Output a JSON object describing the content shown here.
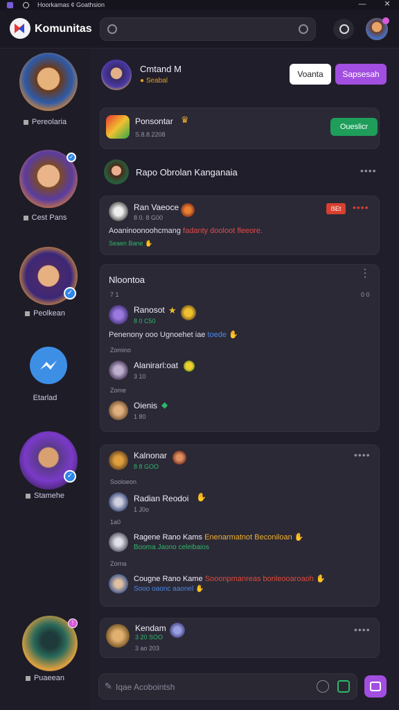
{
  "titlebar": {
    "text": "Hoorkamas ¢ Goathsion"
  },
  "header": {
    "app_name": "Komunitas"
  },
  "sidebar": {
    "items": [
      {
        "label": "Pereolaria"
      },
      {
        "label": "Cest Pans"
      },
      {
        "label": "Peolkean"
      },
      {
        "label": "Etarlad"
      },
      {
        "label": "Stamehe"
      },
      {
        "label": "Puaeean"
      }
    ]
  },
  "profile": {
    "name": "Cmtand M",
    "sub": "Seabal",
    "btn_view": "Voanta",
    "btn_search": "Sapsesah"
  },
  "suggest": {
    "title": "Ponsontar",
    "meta": "S.8.8.2208",
    "btn": "Oueslicr"
  },
  "channel": {
    "title": "Rapo Obrolan Kanganaia"
  },
  "post1": {
    "name": "Ran Vaeoce",
    "meta": "8 0.  8  G00",
    "badge": "ẞEt",
    "body_a": "Aoaninoonoohcmang",
    "body_b": "fadanty dooloot fleeore.",
    "tags": "Seaen  Bane"
  },
  "thread1": {
    "title": "Nloontoa",
    "count": "7 1",
    "count_r": "0 0",
    "c1": {
      "name": "Ranosot",
      "meta": "8  0  C50",
      "body": "Penenony ooo Ugnoehet iae",
      "body_tag": "toede"
    },
    "sep1": "Zomino",
    "c2": {
      "name": "Alanirarl:oat",
      "meta": "3  10"
    },
    "sep2": "Zome",
    "c3": {
      "name": "Oienis",
      "meta": "1  80"
    }
  },
  "thread2": {
    "c1": {
      "name": "Kalnonar",
      "meta": "8  8  GOO"
    },
    "sep1": "Sooloeon",
    "c2": {
      "name": "Radian Reodoi",
      "meta": "1  J0o"
    },
    "sep2": "1a0",
    "c3": {
      "name": "Ragene Rano Kams",
      "hi": "Enenarmatnot Beconiloan",
      "sub": "Booma  Jaono celeibaios"
    },
    "sep3": "Zorna",
    "c4": {
      "name": "Cougne Rano Kame",
      "hi": "Sooonpmanreas bonleooaroaoh",
      "sub": "Sooo  oaonc aaonel"
    }
  },
  "thread3": {
    "name": "Kendam",
    "meta": "3  20  SOO",
    "meta2": "3  ao  203"
  },
  "composer": {
    "placeholder": "Iqae Acobointsh"
  },
  "colors": {
    "accent_purple": "#a24ee0",
    "accent_green": "#1e9e5a",
    "badge_red": "#d8402f",
    "verified_blue": "#2f86e8"
  }
}
